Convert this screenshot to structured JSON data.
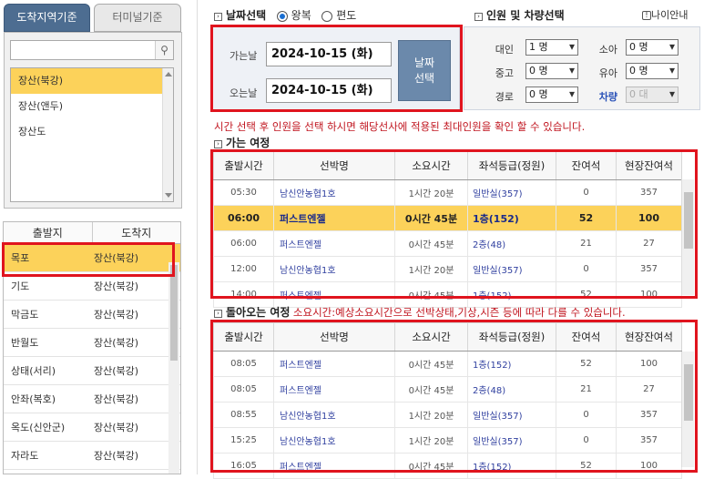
{
  "tabs": {
    "arrival_region": "도착지역기준",
    "terminal": "터미널기준"
  },
  "search": {
    "placeholder": "",
    "icon": "search-icon"
  },
  "regions": [
    "장산(북강)",
    "장산(앤두)",
    "장산도"
  ],
  "route_header": {
    "departure": "출발지",
    "arrival": "도착지"
  },
  "routes": [
    {
      "from": "목포",
      "to": "장산(북강)"
    },
    {
      "from": "기도",
      "to": "장산(북강)"
    },
    {
      "from": "막금도",
      "to": "장산(북강)"
    },
    {
      "from": "반월도",
      "to": "장산(북강)"
    },
    {
      "from": "상태(서리)",
      "to": "장산(북강)"
    },
    {
      "from": "안좌(복호)",
      "to": "장산(북강)"
    },
    {
      "from": "옥도(신안군)",
      "to": "장산(북강)"
    },
    {
      "from": "자라도",
      "to": "장산(북강)"
    }
  ],
  "date_section": {
    "title": "날짜선택",
    "round_trip": "왕복",
    "one_way": "편도"
  },
  "pax_section": {
    "title": "인원 및 차량선택",
    "age_info": "나이안내"
  },
  "dates": {
    "depart_label": "가는날",
    "depart_value": "2024-10-15 (화)",
    "return_label": "오는날",
    "return_value": "2024-10-15 (화)",
    "button": "날짜\n선택",
    "button_line1": "날짜",
    "button_line2": "선택"
  },
  "pax": {
    "adult": {
      "label": "대인",
      "value": "1 명"
    },
    "youth": {
      "label": "중고",
      "value": "0 명"
    },
    "senior": {
      "label": "경로",
      "value": "0 명"
    },
    "child": {
      "label": "소아",
      "value": "0 명"
    },
    "infant": {
      "label": "유아",
      "value": "0 명"
    },
    "vehicle": {
      "label": "차량",
      "value": "0 대"
    }
  },
  "notice": "시간 선택 후 인원을 선택 하시면 해당선사에 적용된 최대인원을 확인 할 수 있습니다.",
  "outbound_title": "가는 여정",
  "return_title": "돌아오는 여정",
  "return_note": "소요시간:예상소요시간으로 선박상태,기상,시즌 등에 따라 다를 수 있습니다.",
  "columns": [
    "출발시간",
    "선박명",
    "소요시간",
    "좌석등급(정원)",
    "잔여석",
    "현장잔여석"
  ],
  "outbound": [
    {
      "time": "05:30",
      "ship": "남신안농협1호",
      "dur": "1시간 20분",
      "seat": "일반실(357)",
      "left": "0",
      "onsite": "357"
    },
    {
      "time": "06:00",
      "ship": "퍼스트엔젤",
      "dur": "0시간 45분",
      "seat": "1층(152)",
      "left": "52",
      "onsite": "100"
    },
    {
      "time": "06:00",
      "ship": "퍼스트엔젤",
      "dur": "0시간 45분",
      "seat": "2층(48)",
      "left": "21",
      "onsite": "27"
    },
    {
      "time": "12:00",
      "ship": "남신안농협1호",
      "dur": "1시간 20분",
      "seat": "일반실(357)",
      "left": "0",
      "onsite": "357"
    },
    {
      "time": "14:00",
      "ship": "퍼스트엔젤",
      "dur": "0시간 45분",
      "seat": "1층(152)",
      "left": "52",
      "onsite": "100"
    }
  ],
  "inbound": [
    {
      "time": "08:05",
      "ship": "퍼스트엔젤",
      "dur": "0시간 45분",
      "seat": "1층(152)",
      "left": "52",
      "onsite": "100"
    },
    {
      "time": "08:05",
      "ship": "퍼스트엔젤",
      "dur": "0시간 45분",
      "seat": "2층(48)",
      "left": "21",
      "onsite": "27"
    },
    {
      "time": "08:55",
      "ship": "남신안농협1호",
      "dur": "1시간 20분",
      "seat": "일반실(357)",
      "left": "0",
      "onsite": "357"
    },
    {
      "time": "15:25",
      "ship": "남신안농협1호",
      "dur": "1시간 20분",
      "seat": "일반실(357)",
      "left": "0",
      "onsite": "357"
    },
    {
      "time": "16:05",
      "ship": "퍼스트엔젤",
      "dur": "0시간 45분",
      "seat": "1층(152)",
      "left": "52",
      "onsite": "100"
    }
  ],
  "colors": {
    "highlight": "#fcd25a",
    "red_box": "#e0141e",
    "tab_active": "#4d6d91",
    "ship_text": "#2f3f9f"
  }
}
